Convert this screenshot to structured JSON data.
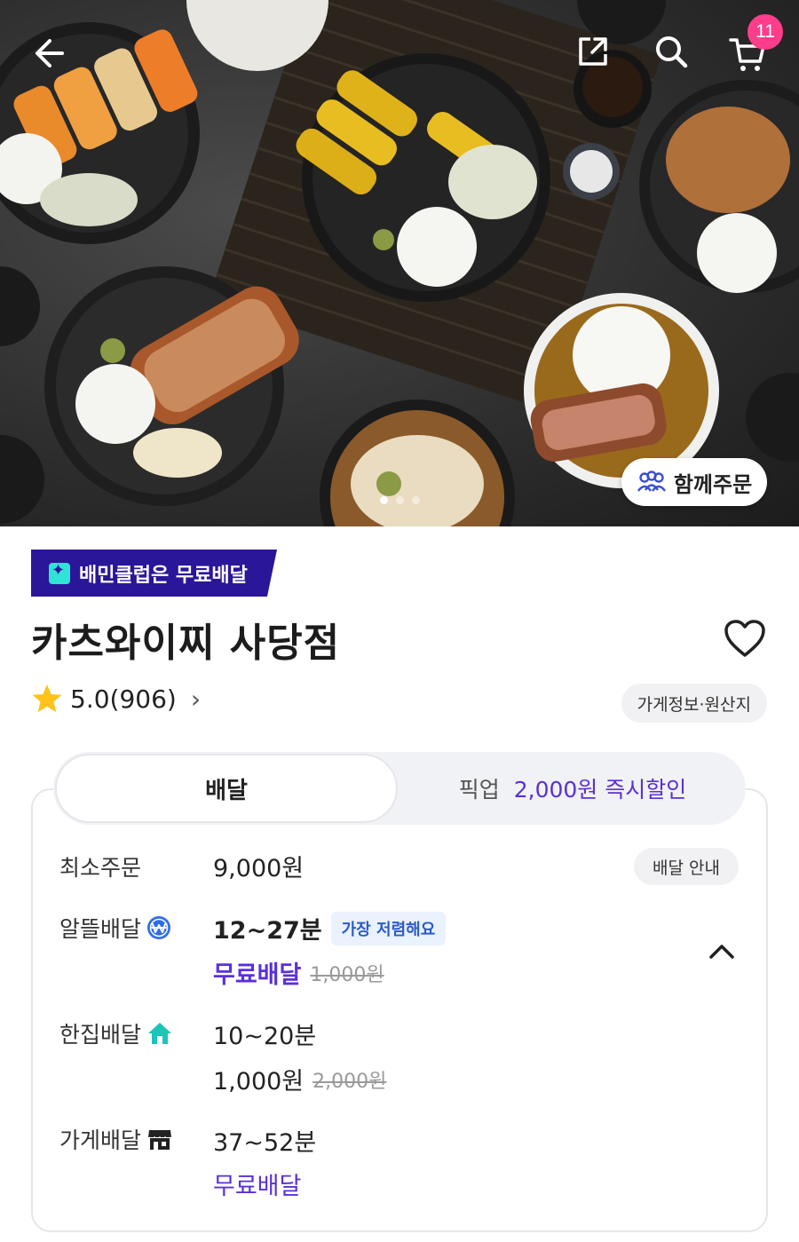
{
  "hero": {
    "cart_count": "11",
    "group_order_label": "함께주문",
    "slides_total": 3,
    "slide_active": 1
  },
  "store": {
    "club_banner": "배민클럽은 무료배달",
    "name": "카츠와이찌 사당점",
    "rating": "5.0(906)",
    "info_chip": "가게정보·원산지"
  },
  "tabs": {
    "delivery": "배달",
    "pickup": "픽업",
    "pickup_promo": "2,000원 즉시할인"
  },
  "delivery": {
    "min_order_label": "최소주문",
    "min_order_value": "9,000원",
    "guide_button": "배달 안내",
    "options": [
      {
        "label": "알뜰배달",
        "icon": "won-badge-icon",
        "time": "12~27분",
        "tag": "가장 저렴해요",
        "fee": "무료배달",
        "fee_original": "1,000원"
      },
      {
        "label": "한집배달",
        "icon": "house-icon",
        "time": "10~20분",
        "tag": "",
        "fee": "1,000원",
        "fee_original": "2,000원"
      },
      {
        "label": "가게배달",
        "icon": "shop-icon",
        "time": "37~52분",
        "tag": "",
        "fee": "무료배달",
        "fee_original": ""
      }
    ]
  },
  "colors": {
    "accent_purple": "#5a30d8",
    "club_banner": "#2a1699",
    "badge_pink": "#ff3d8b",
    "house_teal": "#1cc5b7"
  }
}
